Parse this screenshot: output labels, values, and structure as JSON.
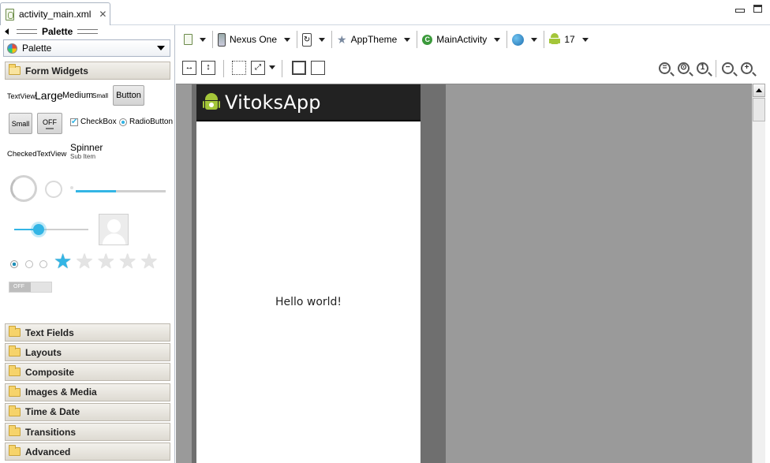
{
  "tab": {
    "title": "activity_main.xml",
    "close_glyph": "ꕤ"
  },
  "window": {
    "min_icon": "minimize-icon",
    "max_icon": "maximize-icon"
  },
  "palette": {
    "title": "Palette",
    "select_value": "Palette",
    "open_category": "Form Widgets",
    "widgets": {
      "textview": "TextView",
      "large": "Large",
      "medium": "Medium",
      "small": "Small",
      "button": "Button",
      "small_button": "Small",
      "toggle_off": "OFF",
      "checkbox": "CheckBox",
      "checkbox_checked": true,
      "radio": "RadioButton",
      "checked_text_view": "CheckedTextView",
      "spinner": "Spinner",
      "spinner_sub": "Sub Item",
      "progress_fraction": 0.45,
      "seek_fraction": 0.33,
      "rating_value": 1,
      "rating_max": 5,
      "switch_off": "OFF"
    },
    "categories": [
      "Text Fields",
      "Layouts",
      "Composite",
      "Images & Media",
      "Time & Date",
      "Transitions",
      "Advanced"
    ]
  },
  "toolbar": {
    "device": "Nexus One",
    "theme": "AppTheme",
    "activity": "MainActivity",
    "api": "17"
  },
  "preview": {
    "app_title": "VitoksApp",
    "hello": "Hello world!"
  },
  "colors": {
    "action_bar": "#222222",
    "accent": "#33b5e5",
    "canvas": "#9a9a9a",
    "android_green": "#a4c639"
  }
}
